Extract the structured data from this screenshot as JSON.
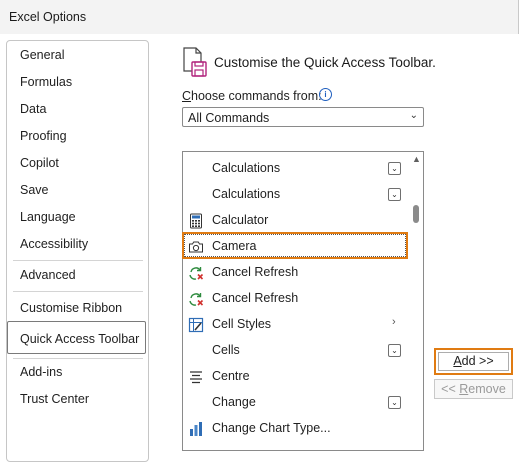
{
  "window": {
    "title": "Excel Options"
  },
  "nav": {
    "items": [
      {
        "label": "General"
      },
      {
        "label": "Formulas"
      },
      {
        "label": "Data"
      },
      {
        "label": "Proofing"
      },
      {
        "label": "Copilot"
      },
      {
        "label": "Save"
      },
      {
        "label": "Language"
      },
      {
        "label": "Accessibility"
      },
      {
        "label": "Advanced"
      },
      {
        "label": "Customise Ribbon"
      },
      {
        "label": "Quick Access Toolbar"
      },
      {
        "label": "Add-ins"
      },
      {
        "label": "Trust Center"
      }
    ],
    "selected": "Quick Access Toolbar"
  },
  "main": {
    "heading": "Customise the Quick Access Toolbar.",
    "choose_label_prefix": "C",
    "choose_label_rest": "hoose commands from:",
    "choose_value": "All Commands",
    "commands": [
      {
        "label": "Calculations",
        "icon": "none",
        "trailing": "dropdown"
      },
      {
        "label": "Calculations",
        "icon": "none",
        "trailing": "dropdown"
      },
      {
        "label": "Calculator",
        "icon": "calculator-icon",
        "trailing": "none"
      },
      {
        "label": "Camera",
        "icon": "camera-icon",
        "trailing": "none"
      },
      {
        "label": "Cancel Refresh",
        "icon": "cancel-refresh-icon",
        "trailing": "none"
      },
      {
        "label": "Cancel Refresh",
        "icon": "cancel-refresh-icon",
        "trailing": "none"
      },
      {
        "label": "Cell Styles",
        "icon": "cell-styles-icon",
        "trailing": "submenu"
      },
      {
        "label": "Cells",
        "icon": "none",
        "trailing": "dropdown"
      },
      {
        "label": "Centre",
        "icon": "align-centre-icon",
        "trailing": "none"
      },
      {
        "label": "Change",
        "icon": "none",
        "trailing": "dropdown"
      },
      {
        "label": "Change Chart Type...",
        "icon": "chart-type-icon",
        "trailing": "none"
      }
    ],
    "selected_command": "Camera"
  },
  "buttons": {
    "add_prefix": "A",
    "add_rest": "dd >>",
    "remove_prefix": "<< ",
    "remove_underlined": "R",
    "remove_rest": "emove"
  },
  "colors": {
    "highlight": "#e07b12"
  }
}
